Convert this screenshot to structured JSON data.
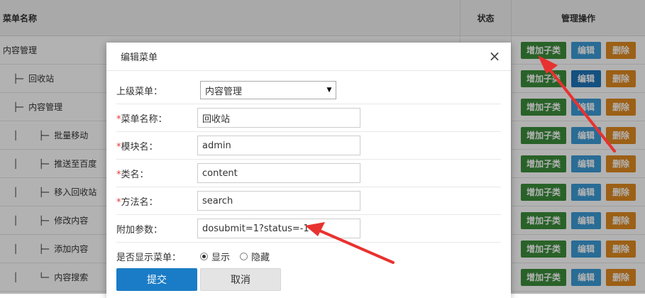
{
  "table": {
    "headers": {
      "name": "菜单名称",
      "status": "状态",
      "ops": "管理操作"
    },
    "rows": [
      {
        "prefix": "",
        "name": "内容管理"
      },
      {
        "prefix": "  ├─ ",
        "name": "回收站"
      },
      {
        "prefix": "  ├─ ",
        "name": "内容管理"
      },
      {
        "prefix": "  │    ├─ ",
        "name": "批量移动"
      },
      {
        "prefix": "  │    ├─ ",
        "name": "推送至百度"
      },
      {
        "prefix": "  │    ├─ ",
        "name": "移入回收站"
      },
      {
        "prefix": "  │    ├─ ",
        "name": "修改内容"
      },
      {
        "prefix": "  │    ├─ ",
        "name": "添加内容"
      },
      {
        "prefix": "  │    └─ ",
        "name": "内容搜索"
      }
    ],
    "btn_add": "增加子类",
    "btn_edit": "编辑",
    "btn_delete": "删除"
  },
  "dialog": {
    "title": "编辑菜单",
    "close_glyph": "×",
    "fields": {
      "parent_label": "上级菜单：",
      "parent_value": "内容管理",
      "name_label": "菜单名称：",
      "name_value": "回收站",
      "module_label": "模块名：",
      "module_value": "admin",
      "class_label": "类名：",
      "class_value": "content",
      "method_label": "方法名：",
      "method_value": "search",
      "params_label": "附加参数：",
      "params_value": "dosubmit=1?status=-1",
      "display_label": "是否显示菜单：",
      "display_show": "显示",
      "display_hide": "隐藏",
      "display_selected": "显示"
    },
    "required_mark": "*",
    "submit": "提交",
    "cancel": "取消"
  },
  "colors": {
    "add": "#3c8d3c",
    "edit": "#3c9bd6",
    "delete": "#e08a20",
    "primary": "#1a7cc6",
    "annotation_arrow": "#e8322f"
  }
}
